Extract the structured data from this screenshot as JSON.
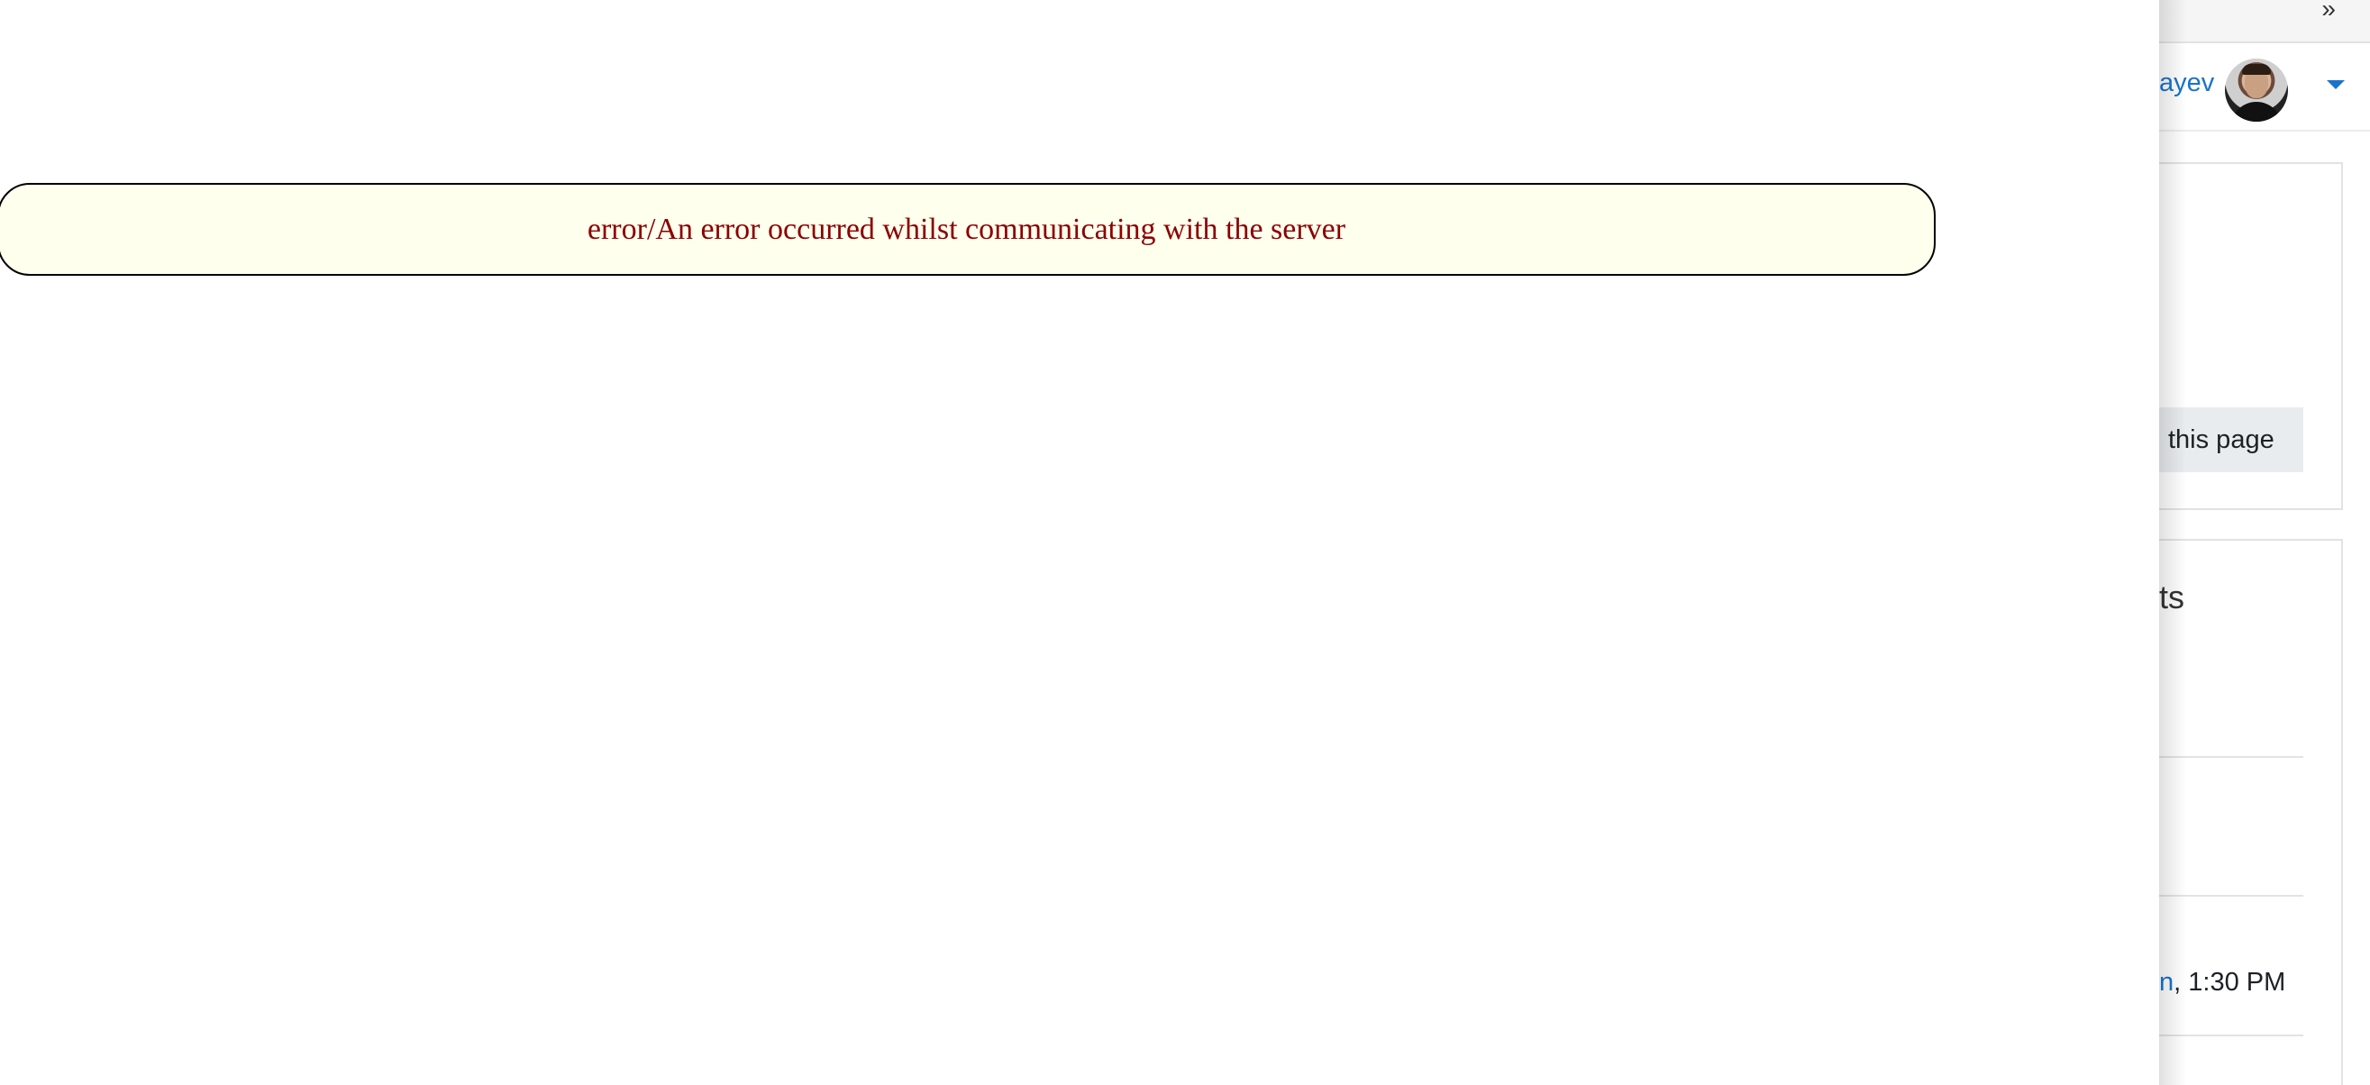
{
  "error": {
    "message": "error/An error occurred whilst communicating with the server"
  },
  "topbar": {
    "collapse_glyph": "»"
  },
  "user_menu": {
    "name_fragment": "ayev",
    "avatar_icon": "user-avatar",
    "caret_icon": "caret-down-icon"
  },
  "block_1": {
    "button_label_fragment": "this page"
  },
  "block_2": {
    "heading_fragment": "ts",
    "event_link_fragment": "n",
    "event_time": ", 1:30 PM"
  },
  "colors": {
    "error_text": "#8b0000",
    "error_bg": "#ffffee",
    "link": "#1a73c9"
  }
}
